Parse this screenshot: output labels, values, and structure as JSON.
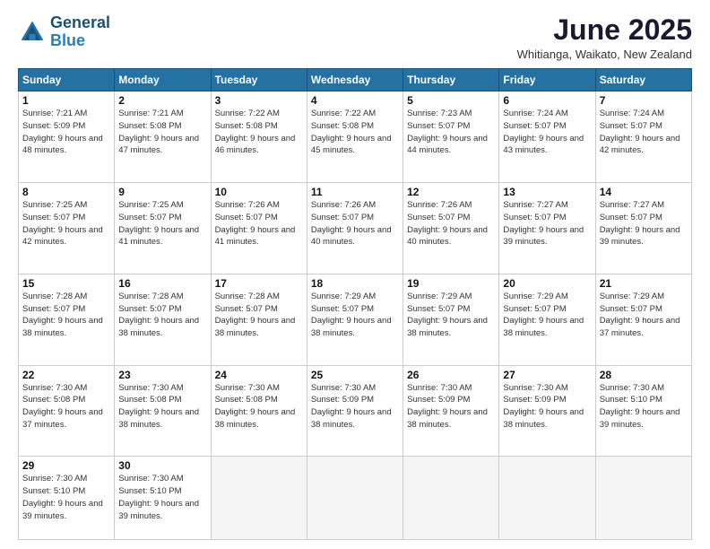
{
  "logo": {
    "line1": "General",
    "line2": "Blue"
  },
  "title": "June 2025",
  "subtitle": "Whitianga, Waikato, New Zealand",
  "days_of_week": [
    "Sunday",
    "Monday",
    "Tuesday",
    "Wednesday",
    "Thursday",
    "Friday",
    "Saturday"
  ],
  "weeks": [
    [
      {
        "day": "1",
        "sunrise": "7:21 AM",
        "sunset": "5:09 PM",
        "daylight": "9 hours and 48 minutes."
      },
      {
        "day": "2",
        "sunrise": "7:21 AM",
        "sunset": "5:08 PM",
        "daylight": "9 hours and 47 minutes."
      },
      {
        "day": "3",
        "sunrise": "7:22 AM",
        "sunset": "5:08 PM",
        "daylight": "9 hours and 46 minutes."
      },
      {
        "day": "4",
        "sunrise": "7:22 AM",
        "sunset": "5:08 PM",
        "daylight": "9 hours and 45 minutes."
      },
      {
        "day": "5",
        "sunrise": "7:23 AM",
        "sunset": "5:07 PM",
        "daylight": "9 hours and 44 minutes."
      },
      {
        "day": "6",
        "sunrise": "7:24 AM",
        "sunset": "5:07 PM",
        "daylight": "9 hours and 43 minutes."
      },
      {
        "day": "7",
        "sunrise": "7:24 AM",
        "sunset": "5:07 PM",
        "daylight": "9 hours and 42 minutes."
      }
    ],
    [
      {
        "day": "8",
        "sunrise": "7:25 AM",
        "sunset": "5:07 PM",
        "daylight": "9 hours and 42 minutes."
      },
      {
        "day": "9",
        "sunrise": "7:25 AM",
        "sunset": "5:07 PM",
        "daylight": "9 hours and 41 minutes."
      },
      {
        "day": "10",
        "sunrise": "7:26 AM",
        "sunset": "5:07 PM",
        "daylight": "9 hours and 41 minutes."
      },
      {
        "day": "11",
        "sunrise": "7:26 AM",
        "sunset": "5:07 PM",
        "daylight": "9 hours and 40 minutes."
      },
      {
        "day": "12",
        "sunrise": "7:26 AM",
        "sunset": "5:07 PM",
        "daylight": "9 hours and 40 minutes."
      },
      {
        "day": "13",
        "sunrise": "7:27 AM",
        "sunset": "5:07 PM",
        "daylight": "9 hours and 39 minutes."
      },
      {
        "day": "14",
        "sunrise": "7:27 AM",
        "sunset": "5:07 PM",
        "daylight": "9 hours and 39 minutes."
      }
    ],
    [
      {
        "day": "15",
        "sunrise": "7:28 AM",
        "sunset": "5:07 PM",
        "daylight": "9 hours and 38 minutes."
      },
      {
        "day": "16",
        "sunrise": "7:28 AM",
        "sunset": "5:07 PM",
        "daylight": "9 hours and 38 minutes."
      },
      {
        "day": "17",
        "sunrise": "7:28 AM",
        "sunset": "5:07 PM",
        "daylight": "9 hours and 38 minutes."
      },
      {
        "day": "18",
        "sunrise": "7:29 AM",
        "sunset": "5:07 PM",
        "daylight": "9 hours and 38 minutes."
      },
      {
        "day": "19",
        "sunrise": "7:29 AM",
        "sunset": "5:07 PM",
        "daylight": "9 hours and 38 minutes."
      },
      {
        "day": "20",
        "sunrise": "7:29 AM",
        "sunset": "5:07 PM",
        "daylight": "9 hours and 38 minutes."
      },
      {
        "day": "21",
        "sunrise": "7:29 AM",
        "sunset": "5:07 PM",
        "daylight": "9 hours and 37 minutes."
      }
    ],
    [
      {
        "day": "22",
        "sunrise": "7:30 AM",
        "sunset": "5:08 PM",
        "daylight": "9 hours and 37 minutes."
      },
      {
        "day": "23",
        "sunrise": "7:30 AM",
        "sunset": "5:08 PM",
        "daylight": "9 hours and 38 minutes."
      },
      {
        "day": "24",
        "sunrise": "7:30 AM",
        "sunset": "5:08 PM",
        "daylight": "9 hours and 38 minutes."
      },
      {
        "day": "25",
        "sunrise": "7:30 AM",
        "sunset": "5:09 PM",
        "daylight": "9 hours and 38 minutes."
      },
      {
        "day": "26",
        "sunrise": "7:30 AM",
        "sunset": "5:09 PM",
        "daylight": "9 hours and 38 minutes."
      },
      {
        "day": "27",
        "sunrise": "7:30 AM",
        "sunset": "5:09 PM",
        "daylight": "9 hours and 38 minutes."
      },
      {
        "day": "28",
        "sunrise": "7:30 AM",
        "sunset": "5:10 PM",
        "daylight": "9 hours and 39 minutes."
      }
    ],
    [
      {
        "day": "29",
        "sunrise": "7:30 AM",
        "sunset": "5:10 PM",
        "daylight": "9 hours and 39 minutes."
      },
      {
        "day": "30",
        "sunrise": "7:30 AM",
        "sunset": "5:10 PM",
        "daylight": "9 hours and 39 minutes."
      },
      null,
      null,
      null,
      null,
      null
    ]
  ]
}
